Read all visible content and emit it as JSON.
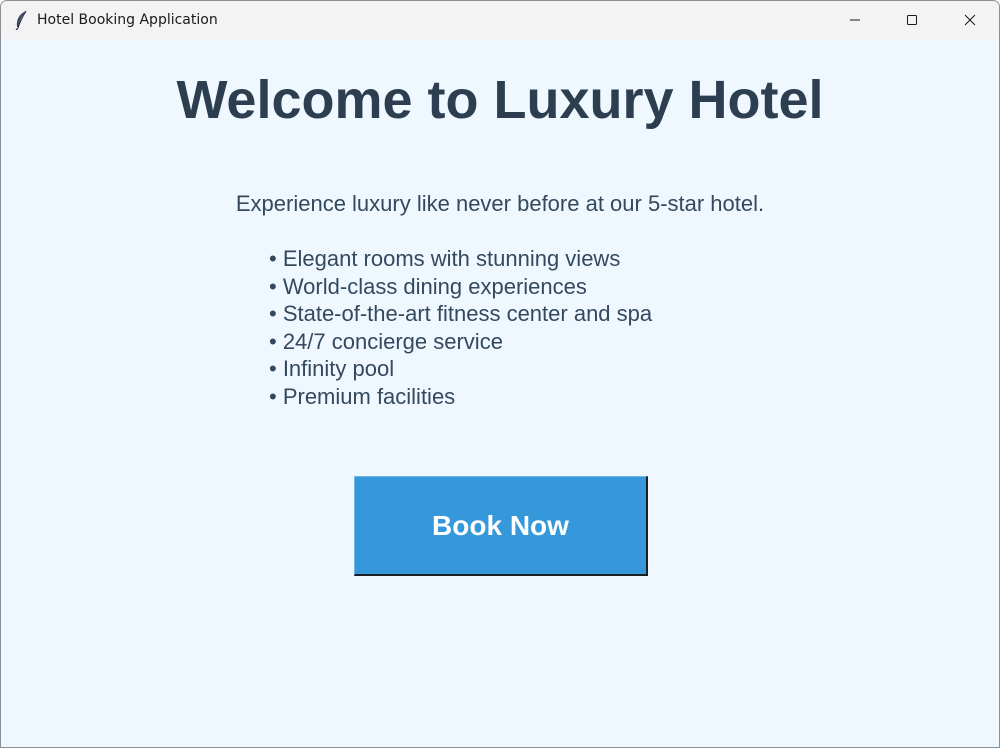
{
  "window": {
    "title": "Hotel Booking Application",
    "icon": "tk-feather-icon",
    "controls": [
      "minimize-icon",
      "maximize-icon",
      "close-icon"
    ]
  },
  "main": {
    "headline": "Welcome to Luxury Hotel",
    "description": "Experience luxury like never before at our 5-star hotel.",
    "features": [
      "• Elegant rooms with stunning views",
      "• World-class dining experiences",
      "• State-of-the-art fitness center and spa",
      "• 24/7 concierge service",
      "• Infinity pool",
      "• Premium facilities"
    ],
    "book_button_label": "Book Now"
  },
  "colors": {
    "background": "#f0f8ff",
    "text_primary": "#2c3e50",
    "text_secondary": "#34495e",
    "button": "#3498db",
    "button_text": "#ffffff"
  }
}
